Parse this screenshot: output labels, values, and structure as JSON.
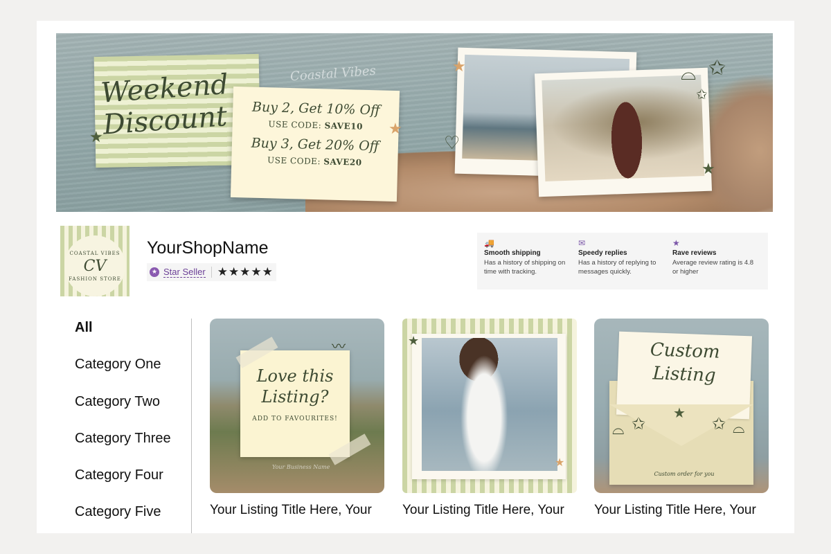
{
  "banner": {
    "headline": "Weekend Discount",
    "tagline": "Coastal Vibes",
    "offers": [
      {
        "text": "Buy 2, Get 10% Off",
        "code_prefix": "USE CODE:",
        "code": "SAVE10"
      },
      {
        "text": "Buy 3, Get 20% Off",
        "code_prefix": "USE CODE:",
        "code": "SAVE20"
      }
    ]
  },
  "shop": {
    "logo": {
      "top_text": "COASTAL VIBES",
      "mark": "CV",
      "bottom_text": "FASHION STORE"
    },
    "name": "YourShopName",
    "badge_label": "Star Seller",
    "rating_stars": "★★★★★",
    "rating": 5
  },
  "features": [
    {
      "icon": "truck-icon",
      "glyph": "🚚",
      "title": "Smooth shipping",
      "description": "Has a history of shipping on time with tracking."
    },
    {
      "icon": "message-icon",
      "glyph": "✉",
      "title": "Speedy replies",
      "description": "Has a history of replying to messages quickly."
    },
    {
      "icon": "star-badge-icon",
      "glyph": "★",
      "title": "Rave reviews",
      "description": "Average review rating is 4.8 or higher"
    }
  ],
  "categories": [
    "All",
    "Category One",
    "Category Two",
    "Category Three",
    "Category Four",
    "Category Five"
  ],
  "listings": [
    {
      "title": "Your Listing Title Here, Your",
      "image_script": "Love this Listing?",
      "image_sub": "ADD TO FAVOURITES!",
      "image_caption": "Your Business Name"
    },
    {
      "title": "Your Listing Title Here, Your"
    },
    {
      "title": "Your Listing Title Here, Your",
      "image_script": "Custom Listing",
      "image_caption": "Custom order for you"
    }
  ],
  "colors": {
    "accent_green": "#3d4a32",
    "stripe_green": "#cbd5a4",
    "badge_purple": "#8a5ab0",
    "star_orange": "#d9a36a"
  }
}
